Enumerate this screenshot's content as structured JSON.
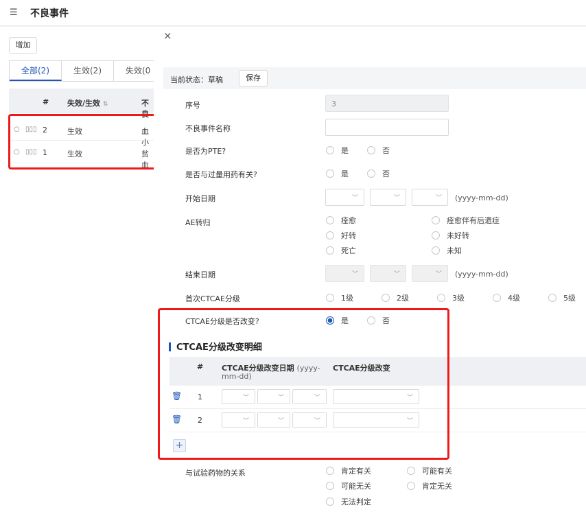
{
  "header": {
    "menu_icon": "☰",
    "title": "不良事件"
  },
  "list": {
    "add_label": "增加",
    "tabs": [
      {
        "label": "全部(2)"
      },
      {
        "label": "生效(2)"
      },
      {
        "label": "失效(0"
      }
    ],
    "columns": {
      "num": "#",
      "status": "失效/生效",
      "type": "不良"
    },
    "rows": [
      {
        "num": "2",
        "status": "生效",
        "type": "血小"
      },
      {
        "num": "1",
        "status": "生效",
        "type": "贫血"
      }
    ]
  },
  "drawer": {
    "close_icon": "×",
    "status_label": "当前状态：草稿",
    "save_label": "保存",
    "fields": {
      "seq_label": "序号",
      "seq_value": "3",
      "name_label": "不良事件名称",
      "pte_label": "是否为PTE?",
      "overdose_label": "是否与过量用药有关?",
      "start_label": "开始日期",
      "date_format": "(yyyy-mm-dd)",
      "outcome_label": "AE转归",
      "end_label": "结束日期",
      "ctcae_first_label": "首次CTCAE分级",
      "ctcae_change_label": "CTCAE分级是否改变?",
      "relation_label": "与试验药物的关系"
    },
    "yes": "是",
    "no": "否",
    "outcomes": [
      "痊愈",
      "痊愈伴有后遗症",
      "好转",
      "未好转",
      "死亡",
      "未知"
    ],
    "grades": [
      "1级",
      "2级",
      "3级",
      "4级",
      "5级"
    ],
    "relations": [
      "肯定有关",
      "可能有关",
      "可能无关",
      "肯定无关",
      "无法判定"
    ],
    "section_title": "CTCAE分级改变明细",
    "detail_columns": {
      "num": "#",
      "date": "CTCAE分级改变日期",
      "date_fmt1": "(yyyy-",
      "date_fmt2": "mm-dd)",
      "change": "CTCAE分级改变"
    },
    "detail_rows": [
      {
        "num": "1"
      },
      {
        "num": "2"
      }
    ],
    "add_icon": "+"
  },
  "colors": {
    "accent": "#1f57b7",
    "highlight": "#ee1a1a"
  }
}
